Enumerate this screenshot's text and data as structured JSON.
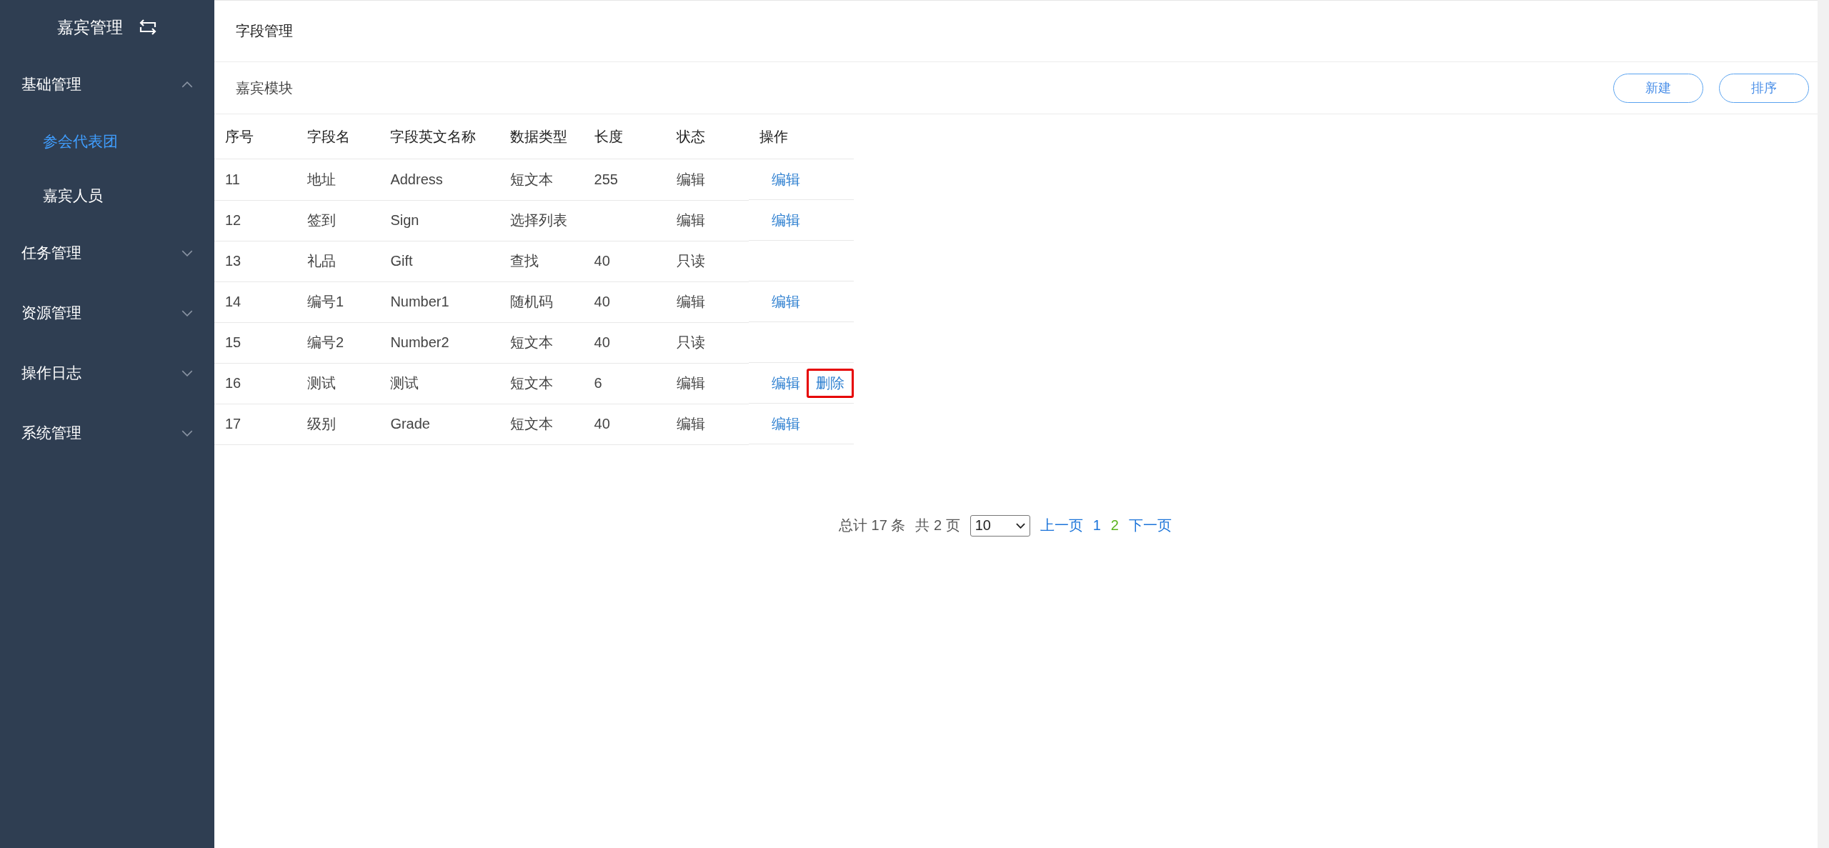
{
  "sidebar": {
    "title": "嘉宾管理",
    "groups": [
      {
        "label": "基础管理",
        "expanded": true,
        "items": [
          {
            "label": "参会代表团",
            "selected": true
          },
          {
            "label": "嘉宾人员",
            "selected": false
          }
        ]
      },
      {
        "label": "任务管理",
        "expanded": false
      },
      {
        "label": "资源管理",
        "expanded": false
      },
      {
        "label": "操作日志",
        "expanded": false
      },
      {
        "label": "系统管理",
        "expanded": false
      }
    ]
  },
  "page_title": "字段管理",
  "section": {
    "title": "嘉宾模块",
    "buttons": [
      "新建",
      "排序"
    ]
  },
  "table": {
    "columns": [
      "序号",
      "字段名",
      "字段英文名称",
      "数据类型",
      "长度",
      "状态",
      "操作"
    ],
    "rows": [
      {
        "cells": [
          "11",
          "地址",
          "Address",
          "短文本",
          "255",
          "编辑"
        ],
        "actions": [
          {
            "label": "编辑",
            "highlighted": false
          }
        ]
      },
      {
        "cells": [
          "12",
          "签到",
          "Sign",
          "选择列表",
          "",
          "编辑"
        ],
        "actions": [
          {
            "label": "编辑",
            "highlighted": false
          }
        ]
      },
      {
        "cells": [
          "13",
          "礼品",
          "Gift",
          "查找",
          "40",
          "只读"
        ],
        "actions": []
      },
      {
        "cells": [
          "14",
          "编号1",
          "Number1",
          "随机码",
          "40",
          "编辑"
        ],
        "actions": [
          {
            "label": "编辑",
            "highlighted": false
          }
        ]
      },
      {
        "cells": [
          "15",
          "编号2",
          "Number2",
          "短文本",
          "40",
          "只读"
        ],
        "actions": []
      },
      {
        "cells": [
          "16",
          "测试",
          "测试",
          "短文本",
          "6",
          "编辑"
        ],
        "actions": [
          {
            "label": "编辑",
            "highlighted": false
          },
          {
            "label": "删除",
            "highlighted": true
          }
        ]
      },
      {
        "cells": [
          "17",
          "级别",
          "Grade",
          "短文本",
          "40",
          "编辑"
        ],
        "actions": [
          {
            "label": "编辑",
            "highlighted": false
          }
        ]
      }
    ]
  },
  "pagination": {
    "total": "总计 17 条",
    "pages_text": "共 2 页",
    "page_size": "10",
    "prev": "上一页",
    "pages": [
      {
        "label": "1",
        "selected": false
      },
      {
        "label": "2",
        "selected": true
      }
    ],
    "next": "下一页"
  }
}
